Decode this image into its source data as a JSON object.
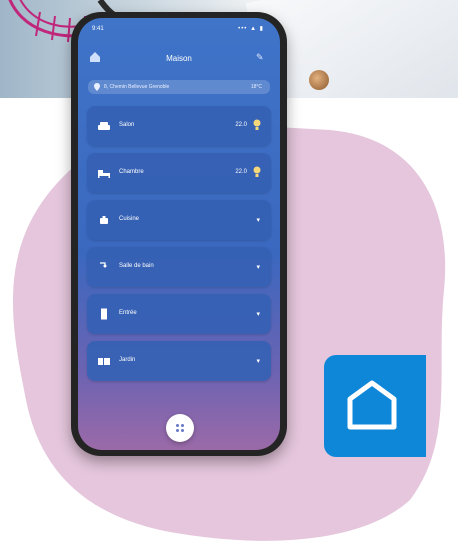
{
  "colors": {
    "blob": "#e5c6dc",
    "screen_top": "#3f74c9",
    "room_card": "#3561b4",
    "app_tile": "#0e87d8",
    "bulb": "#f6d77a"
  },
  "status_bar": {
    "time": "9:41",
    "signal": "••• ▲ ▮"
  },
  "header": {
    "title": "Maison",
    "home_icon": "home-icon",
    "edit_icon": "pencil-icon"
  },
  "weather": {
    "location": "8, Chemin Bellevue Grenoble",
    "temperature": "18°C"
  },
  "rooms": [
    {
      "name": "Salon",
      "value": "22.0",
      "icon": "sofa-icon",
      "trailing": "bulb-icon"
    },
    {
      "name": "Chambre",
      "value": "22.0",
      "icon": "bed-icon",
      "trailing": "bulb-icon"
    },
    {
      "name": "Cuisine",
      "value": "",
      "icon": "pot-icon",
      "trailing": "chevron-down-icon"
    },
    {
      "name": "Salle de bain",
      "value": "",
      "icon": "shower-icon",
      "trailing": "chevron-down-icon"
    },
    {
      "name": "Entrée",
      "value": "",
      "icon": "door-icon",
      "trailing": "chevron-down-icon"
    },
    {
      "name": "Jardin",
      "value": "",
      "icon": "garden-icon",
      "trailing": "chevron-down-icon"
    }
  ],
  "fab_icon": "grid-dots-icon",
  "app_tile_icon": "house-outline-icon"
}
